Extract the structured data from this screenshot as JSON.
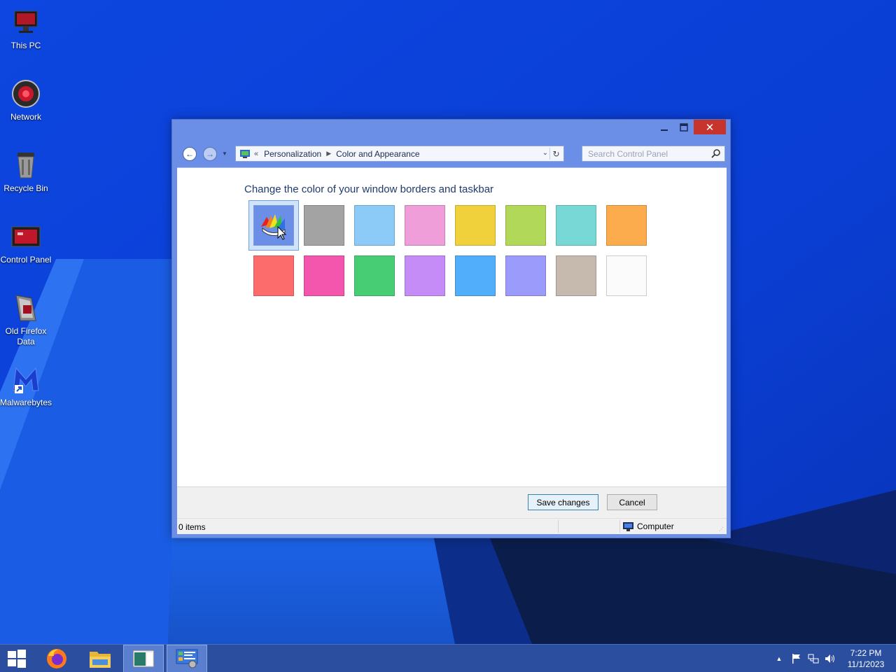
{
  "desktop": {
    "icons": [
      {
        "label": "This PC",
        "icon": "computer-icon"
      },
      {
        "label": "Network",
        "icon": "network-icon"
      },
      {
        "label": "Recycle Bin",
        "icon": "recycle-bin-icon"
      },
      {
        "label": "Control Panel",
        "icon": "control-panel-icon"
      },
      {
        "label": "Old Firefox Data",
        "icon": "folder-shortcut-icon"
      },
      {
        "label": "Malwarebytes",
        "icon": "malwarebytes-icon"
      }
    ]
  },
  "window": {
    "buttons": {
      "minimize": "▁",
      "maximize": "□",
      "close": "✕"
    },
    "nav": {
      "back": "←",
      "forward": "→",
      "breadcrumb_prefix": "«",
      "breadcrumb": [
        "Personalization",
        "Color and Appearance"
      ],
      "search_placeholder": "Search Control Panel"
    },
    "heading": "Change the color of your window borders and taskbar",
    "swatches": [
      {
        "name": "automatic-color",
        "color": "#6b8fe6"
      },
      {
        "name": "gray",
        "color": "#a3a3a3"
      },
      {
        "name": "sky-blue",
        "color": "#8ccaf8"
      },
      {
        "name": "pink",
        "color": "#f09ed9"
      },
      {
        "name": "yellow",
        "color": "#f0d13c"
      },
      {
        "name": "lime",
        "color": "#b1d858"
      },
      {
        "name": "teal",
        "color": "#77d8d6"
      },
      {
        "name": "orange",
        "color": "#fcac4c"
      },
      {
        "name": "coral",
        "color": "#fd6c6c"
      },
      {
        "name": "magenta",
        "color": "#f455ad"
      },
      {
        "name": "green",
        "color": "#47ce75"
      },
      {
        "name": "lavender",
        "color": "#c58bf6"
      },
      {
        "name": "blue",
        "color": "#50aefb"
      },
      {
        "name": "periwinkle",
        "color": "#9b9bfb"
      },
      {
        "name": "taupe",
        "color": "#c6b9ad"
      },
      {
        "name": "white",
        "color": "#fbfbfb"
      }
    ],
    "save_label": "Save changes",
    "cancel_label": "Cancel",
    "status": {
      "items": "0 items",
      "location": "Computer"
    }
  },
  "taskbar": {
    "items": [
      {
        "name": "start-button",
        "icon": "windows-logo-icon"
      },
      {
        "name": "firefox",
        "icon": "firefox-icon"
      },
      {
        "name": "file-explorer",
        "icon": "folder-icon"
      },
      {
        "name": "app-window",
        "icon": "window-app-icon"
      },
      {
        "name": "control-panel",
        "icon": "control-panel-icon"
      }
    ],
    "clock": {
      "time": "7:22 PM",
      "date": "11/1/2023"
    }
  }
}
